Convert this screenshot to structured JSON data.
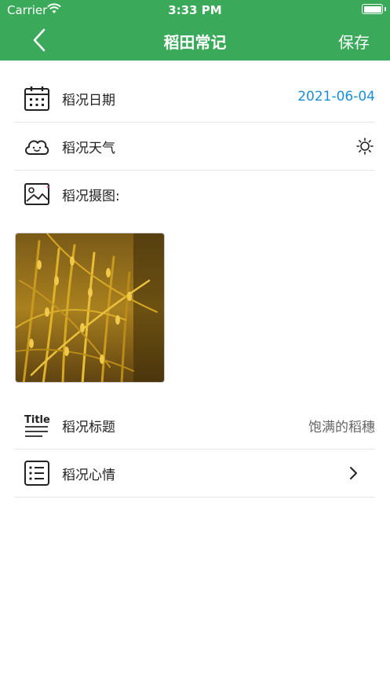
{
  "status_bar": {
    "carrier": "Carrier",
    "time": "3:33 PM",
    "battery_level": 1.0
  },
  "nav": {
    "title": "稻田常记",
    "save_label": "保存",
    "back_icon": "chevron-left-icon"
  },
  "form": {
    "date": {
      "label": "稻况日期",
      "value": "2021-06-04",
      "icon": "calendar-icon",
      "value_color": "#1a8fd6"
    },
    "weather": {
      "label": "稻况天气",
      "icon": "cloud-icon",
      "value_icon": "sun-icon"
    },
    "photo": {
      "label": "稻况摄图:",
      "icon": "image-icon",
      "thumbnail": "rice-field-photo"
    },
    "title": {
      "label": "稻况标题",
      "value": "饱满的稻穗",
      "icon": "title-text-icon",
      "icon_text": "Title"
    },
    "mood": {
      "label": "稻况心情",
      "icon": "list-icon",
      "value_icon": "chevron-right-icon"
    }
  },
  "colors": {
    "accent": "#3aaa5a",
    "date_value": "#1a8fd6"
  }
}
